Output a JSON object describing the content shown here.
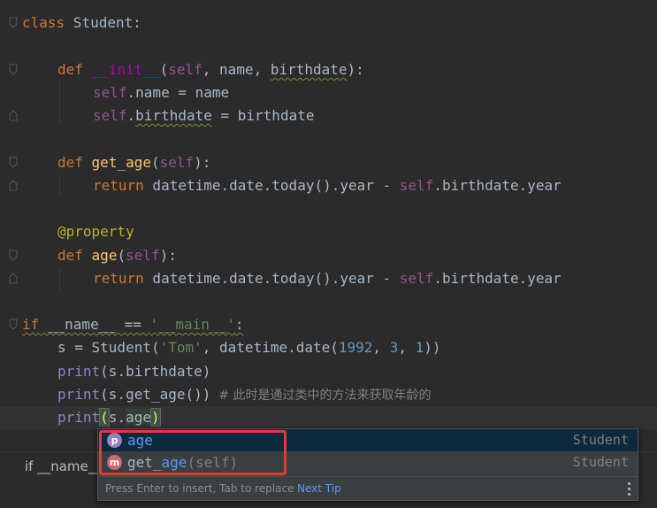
{
  "code": {
    "l1_kw": "class",
    "l1_rest": " Student:",
    "l2_kw": "def",
    "l2_fn": "__init__",
    "l2_open": "(",
    "l2_self": "self",
    "l2_a": ", name, ",
    "l2_b": "birthdate",
    "l2_close": "):",
    "l3_self": "self",
    "l3_rest": ".name = name",
    "l4_self": "self",
    "l4_dot": ".",
    "l4_attr": "birthdate",
    "l4_rest": " = birthdate",
    "l5_kw": "def",
    "l5_fn": "get_age",
    "l5_open": "(",
    "l5_self": "self",
    "l5_close": "):",
    "l6_kw": "return",
    "l6_a": " datetime.date.today().year - ",
    "l6_self": "self",
    "l6_b": ".birthdate.year",
    "l7_dec": "@property",
    "l8_kw": "def",
    "l8_fn": "age",
    "l8_open": "(",
    "l8_self": "self",
    "l8_close": "):",
    "l9_kw": "return",
    "l9_a": " datetime.date.today().year - ",
    "l9_self": "self",
    "l9_b": ".birthdate.year",
    "l10_kw": "if",
    "l10_a": " __name__ == ",
    "l10_str": "'__main__'",
    "l10_colon": ":",
    "l11_a": "s = Student(",
    "l11_str": "'Tom'",
    "l11_b": ", datetime.date(",
    "l11_n1": "1992",
    "l11_c1": ", ",
    "l11_n2": "3",
    "l11_c2": ", ",
    "l11_n3": "1",
    "l11_end": "))",
    "l12_fn": "print",
    "l12_rest": "(s.birthdate)",
    "l13_fn": "print",
    "l13_rest": "(s.get_age())",
    "l13_cmt": "  # 此时是通过类中的方法来获取年龄的",
    "l14_fn": "print",
    "l14_open": "(",
    "l14_mid": "s.",
    "l14_ident": "age",
    "l14_close": ")"
  },
  "status_bar": {
    "text": "if __name__"
  },
  "completion": {
    "items": [
      {
        "badge": "p",
        "match": "age",
        "rest": "",
        "sig": "",
        "type": "Student"
      },
      {
        "badge": "m",
        "prefix": "get_",
        "match": "age",
        "sig": "(self)",
        "type": "Student"
      }
    ],
    "hint": "Press Enter to insert, Tab to replace",
    "next_tip": "Next Tip"
  },
  "colors": {
    "background": "#2b2b2b",
    "keyword": "#cc7832",
    "function": "#ffc66d",
    "highlight_box": "#e53935"
  }
}
